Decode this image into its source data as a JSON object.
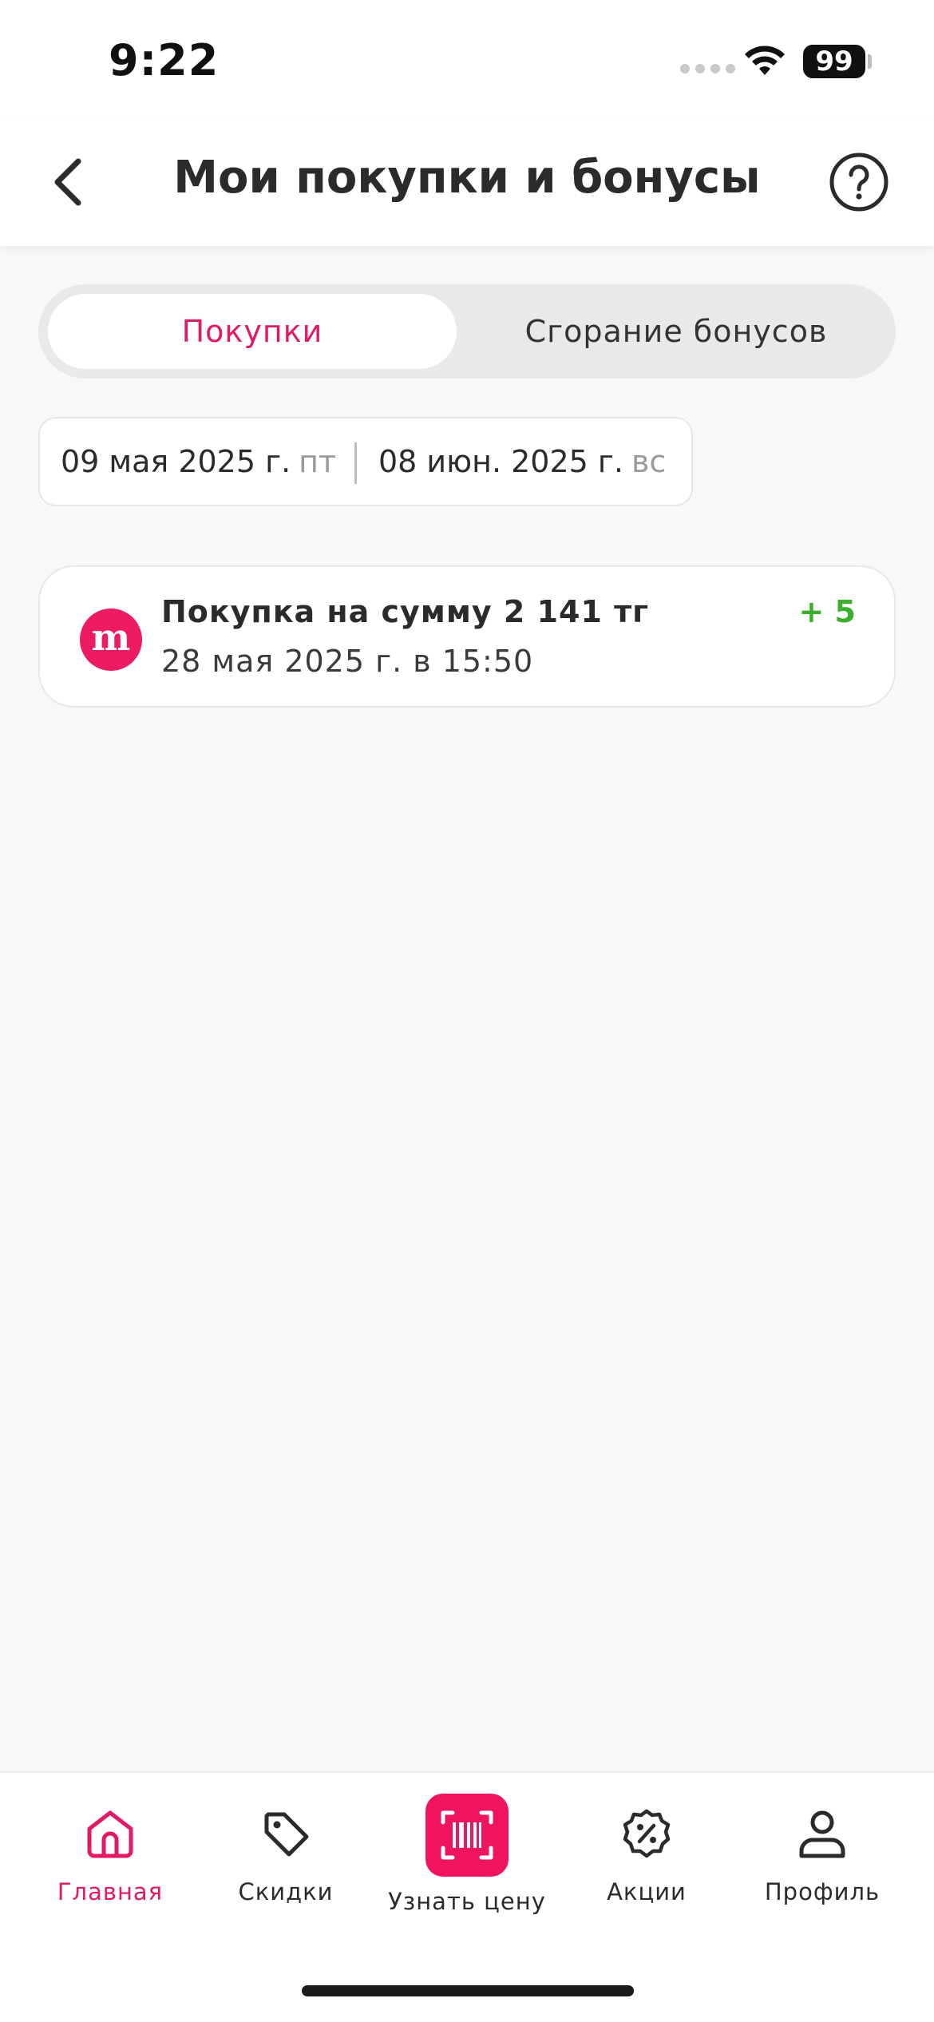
{
  "status_bar": {
    "time": "9:22",
    "battery": "99"
  },
  "header": {
    "title": "Мои покупки и бонусы",
    "back_icon": "chevron-left-icon",
    "help_icon": "question-circle-icon"
  },
  "segments": {
    "tabs": [
      {
        "label": "Покупки",
        "active": true
      },
      {
        "label": "Сгорание бонусов",
        "active": false
      }
    ]
  },
  "date_range": {
    "from": {
      "date": "09 мая 2025 г.",
      "day": "пт"
    },
    "to": {
      "date": "08 июн. 2025 г.",
      "day": "вс"
    }
  },
  "purchases": [
    {
      "title": "Покупка на сумму 2 141 тг",
      "datetime": "28 мая 2025 г. в 15:50",
      "bonus": "+ 5",
      "logo_text": "m"
    }
  ],
  "tab_bar": {
    "items": [
      {
        "label": "Главная",
        "icon": "home-icon",
        "active": true
      },
      {
        "label": "Скидки",
        "icon": "tag-icon",
        "active": false
      },
      {
        "label": "Узнать цену",
        "icon": "barcode-scan-icon",
        "active": false
      },
      {
        "label": "Акции",
        "icon": "percent-badge-icon",
        "active": false
      },
      {
        "label": "Профиль",
        "icon": "user-icon",
        "active": false
      }
    ]
  },
  "colors": {
    "accent": "#e01a66",
    "scan_button": "#f0145f",
    "bonus_positive": "#3bb02c",
    "background": "#f8f8f8"
  }
}
